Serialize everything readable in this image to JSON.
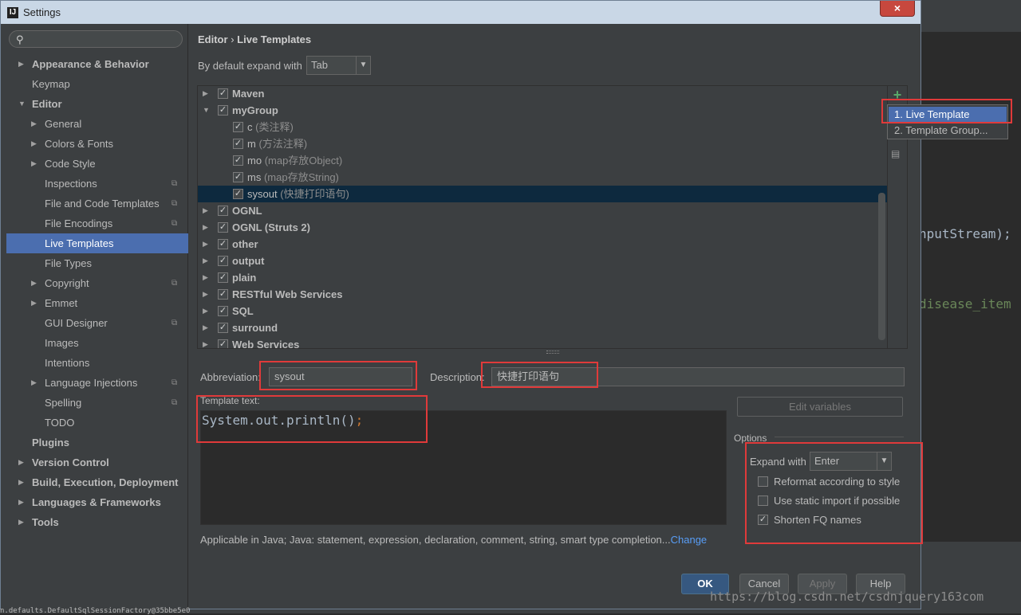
{
  "window": {
    "title": "Settings",
    "close_label": "×",
    "app_icon": "IJ"
  },
  "sidebar": {
    "search_placeholder": "",
    "items": [
      {
        "label": "Appearance & Behavior",
        "arrow": "▶",
        "bold": true
      },
      {
        "label": "Keymap"
      },
      {
        "label": "Editor",
        "arrow": "▼",
        "bold": true
      },
      {
        "label": "General",
        "arrow": "▶"
      },
      {
        "label": "Colors & Fonts",
        "arrow": "▶"
      },
      {
        "label": "Code Style",
        "arrow": "▶"
      },
      {
        "label": "Inspections",
        "copy": true
      },
      {
        "label": "File and Code Templates",
        "copy": true
      },
      {
        "label": "File Encodings",
        "copy": true
      },
      {
        "label": "Live Templates",
        "selected": true
      },
      {
        "label": "File Types"
      },
      {
        "label": "Copyright",
        "arrow": "▶",
        "copy": true
      },
      {
        "label": "Emmet",
        "arrow": "▶"
      },
      {
        "label": "GUI Designer",
        "copy": true
      },
      {
        "label": "Images"
      },
      {
        "label": "Intentions"
      },
      {
        "label": "Language Injections",
        "arrow": "▶",
        "copy": true
      },
      {
        "label": "Spelling",
        "copy": true
      },
      {
        "label": "TODO"
      },
      {
        "label": "Plugins",
        "bold": true
      },
      {
        "label": "Version Control",
        "arrow": "▶",
        "bold": true
      },
      {
        "label": "Build, Execution, Deployment",
        "arrow": "▶",
        "bold": true
      },
      {
        "label": "Languages & Frameworks",
        "arrow": "▶",
        "bold": true
      },
      {
        "label": "Tools",
        "arrow": "▶",
        "bold": true
      }
    ]
  },
  "breadcrumb": {
    "parent": "Editor",
    "sep": "›",
    "current": "Live Templates"
  },
  "expand_default": {
    "label": "By default expand with",
    "value": "Tab"
  },
  "tree": [
    {
      "name": "Maven",
      "arrow": "▶",
      "checked": true,
      "group": true
    },
    {
      "name": "myGroup",
      "arrow": "▼",
      "checked": true,
      "group": true
    },
    {
      "name": "c",
      "desc": "(类注释)",
      "checked": true
    },
    {
      "name": "m",
      "desc": "(方法注释)",
      "checked": true
    },
    {
      "name": "mo",
      "desc": "(map存放Object)",
      "checked": true
    },
    {
      "name": "ms",
      "desc": "(map存放String)",
      "checked": true
    },
    {
      "name": "sysout",
      "desc": "(快捷打印语句)",
      "checked": true,
      "selected": true
    },
    {
      "name": "OGNL",
      "arrow": "▶",
      "checked": true,
      "group": true
    },
    {
      "name": "OGNL (Struts 2)",
      "arrow": "▶",
      "checked": true,
      "group": true
    },
    {
      "name": "other",
      "arrow": "▶",
      "checked": true,
      "group": true
    },
    {
      "name": "output",
      "arrow": "▶",
      "checked": true,
      "group": true
    },
    {
      "name": "plain",
      "arrow": "▶",
      "checked": true,
      "group": true
    },
    {
      "name": "RESTful Web Services",
      "arrow": "▶",
      "checked": true,
      "group": true
    },
    {
      "name": "SQL",
      "arrow": "▶",
      "checked": true,
      "group": true
    },
    {
      "name": "surround",
      "arrow": "▶",
      "checked": true,
      "group": true
    },
    {
      "name": "Web Services",
      "arrow": "▶",
      "checked": true,
      "group": true
    }
  ],
  "add_popup": {
    "items": [
      "1. Live Template",
      "2. Template Group..."
    ]
  },
  "abbreviation": {
    "label": "Abbreviation:",
    "value": "sysout"
  },
  "description": {
    "label": "Description:",
    "value": "快捷打印语句"
  },
  "template_text": {
    "label": "Template text:",
    "code": "System.out.println()",
    "semi": ";"
  },
  "edit_variables": "Edit variables",
  "options": {
    "title": "Options",
    "expand_label": "Expand with",
    "expand_value": "Enter",
    "checkboxes": [
      {
        "label": "Reformat according to style",
        "checked": false
      },
      {
        "label": "Use static import if possible",
        "checked": false
      },
      {
        "label": "Shorten FQ names",
        "checked": true
      }
    ]
  },
  "applicable": {
    "text": "Applicable in Java; Java: statement, expression, declaration, comment, string, smart type completion...",
    "link": "Change"
  },
  "buttons": {
    "ok": "OK",
    "cancel": "Cancel",
    "apply": "Apply",
    "help": "Help"
  },
  "background_ide": {
    "code_line_1": "nputStream);",
    "code_line_2": "disease_item"
  },
  "watermark": "https://blog.csdn.net/csdnjquery163com",
  "bottom_text": "n.defaults.DefaultSqlSessionFactory@35bbe5e0"
}
